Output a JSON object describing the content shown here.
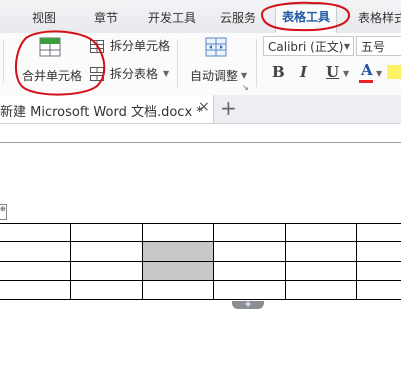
{
  "tabs": [
    {
      "label": "视图"
    },
    {
      "label": "章节"
    },
    {
      "label": "开发工具"
    },
    {
      "label": "云服务"
    },
    {
      "label": "表格工具"
    },
    {
      "label": "表格样式"
    }
  ],
  "ribbon": {
    "merge_cells": "合并单元格",
    "split_cells": "拆分单元格",
    "split_table": "拆分表格",
    "auto_fit": "自动调整",
    "font_name": "Calibri (正文)",
    "font_size": "五号",
    "bold": "B",
    "italic": "I",
    "underline": "U",
    "font_color": "A"
  },
  "document_tab": {
    "title": "新建 Microsoft Word 文档.docx *",
    "close": "×",
    "new_tab": "+"
  },
  "table": {
    "add_row": "+"
  },
  "colors": {
    "active_tab_text": "#1f5ba8",
    "annotation_red": "#d4101a",
    "selected_cell": "#c8c8c8",
    "font_color_bar": "#e8212b"
  },
  "icons": [
    "merge-cells-icon",
    "split-cells-icon",
    "split-table-icon",
    "auto-fit-icon",
    "close-icon",
    "plus-icon"
  ]
}
